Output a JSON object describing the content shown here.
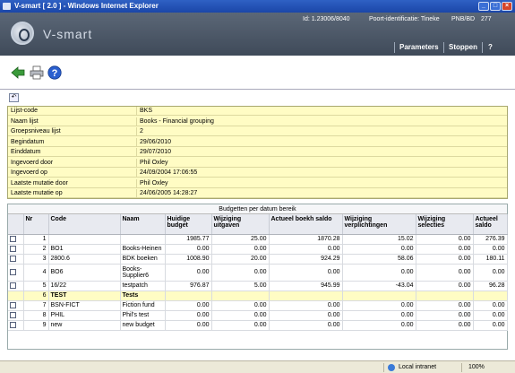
{
  "window": {
    "title": "V-smart [ 2.0 ] - Windows Internet Explorer"
  },
  "header": {
    "logo_text": "V-smart",
    "id_text": "Id: 1.23006/8040",
    "location_text": "Poort-identificatie: Tineke",
    "branch_text": "PNB/BD",
    "count_text": "277"
  },
  "nav": {
    "parameters": "Parameters",
    "stop": "Stoppen",
    "help": "?"
  },
  "info": [
    {
      "label": "Lijst-code",
      "value": "BKS"
    },
    {
      "label": "Naam lijst",
      "value": "Books - Financial grouping"
    },
    {
      "label": "Groepsniveau lijst",
      "value": "2"
    },
    {
      "label": "Begindatum",
      "value": "29/06/2010"
    },
    {
      "label": "Einddatum",
      "value": "29/07/2010"
    },
    {
      "label": "Ingevoerd door",
      "value": "Phil Oxley"
    },
    {
      "label": "Ingevoerd op",
      "value": "24/09/2004 17:06:55"
    },
    {
      "label": "Laatste mutatie door",
      "value": "Phil Oxley"
    },
    {
      "label": "Laatste mutatie op",
      "value": "24/06/2005 14:28:27"
    }
  ],
  "grid": {
    "title": "Budgetten per datum bereik",
    "headers": [
      "Nr",
      "Code",
      "Naam",
      "Huidige budget",
      "Wijziging uitgaven",
      "Actueel boekh saldo",
      "Wijziging verplichtingen",
      "Wijziging selecties",
      "Actueel saldo"
    ],
    "rows": [
      {
        "nr": "1",
        "code": "",
        "naam": "",
        "budget": "1985.77",
        "uitgaven": "25.00",
        "boekh": "1870.28",
        "verpl": "15.02",
        "sel": "0.00",
        "saldo": "276.39"
      },
      {
        "nr": "2",
        "code": "BO1",
        "naam": "Books-Heinen",
        "budget": "0.00",
        "uitgaven": "0.00",
        "boekh": "0.00",
        "verpl": "0.00",
        "sel": "0.00",
        "saldo": "0.00"
      },
      {
        "nr": "3",
        "code": "2800.6",
        "naam": "BDK boeken",
        "budget": "1008.90",
        "uitgaven": "20.00",
        "boekh": "924.29",
        "verpl": "58.06",
        "sel": "0.00",
        "saldo": "180.11"
      },
      {
        "nr": "4",
        "code": "BO6",
        "naam": "Books-Supplier6",
        "budget": "0.00",
        "uitgaven": "0.00",
        "boekh": "0.00",
        "verpl": "0.00",
        "sel": "0.00",
        "saldo": "0.00"
      },
      {
        "nr": "5",
        "code": "16/22",
        "naam": "testpatch",
        "budget": "976.87",
        "uitgaven": "5.00",
        "boekh": "945.99",
        "verpl": "-43.04",
        "sel": "0.00",
        "saldo": "96.28"
      },
      {
        "nr": "6",
        "code": "TEST",
        "naam": "Tests",
        "budget": "",
        "uitgaven": "",
        "boekh": "",
        "verpl": "",
        "sel": "",
        "saldo": ""
      },
      {
        "nr": "7",
        "code": "BSN-FICT",
        "naam": "Fiction fund",
        "budget": "0.00",
        "uitgaven": "0.00",
        "boekh": "0.00",
        "verpl": "0.00",
        "sel": "0.00",
        "saldo": "0.00"
      },
      {
        "nr": "8",
        "code": "PHIL",
        "naam": "Phil's test",
        "budget": "0.00",
        "uitgaven": "0.00",
        "boekh": "0.00",
        "verpl": "0.00",
        "sel": "0.00",
        "saldo": "0.00"
      },
      {
        "nr": "9",
        "code": "new",
        "naam": "new budget",
        "budget": "0.00",
        "uitgaven": "0.00",
        "boekh": "0.00",
        "verpl": "0.00",
        "sel": "0.00",
        "saldo": "0.00"
      }
    ]
  },
  "status": {
    "zone": "Local intranet",
    "zoom": "100%"
  },
  "colors": {
    "titlebar": "#2f61c4",
    "header": "#4b5666",
    "info_bg": "#fffcc4",
    "toolbar_arrow": "#3a9a3a",
    "help_icon": "#2a5fcf"
  },
  "icons": [
    "back-arrow-icon",
    "printer-icon",
    "help-icon",
    "undo-icon",
    "checkbox-icon",
    "globe-icon"
  ]
}
